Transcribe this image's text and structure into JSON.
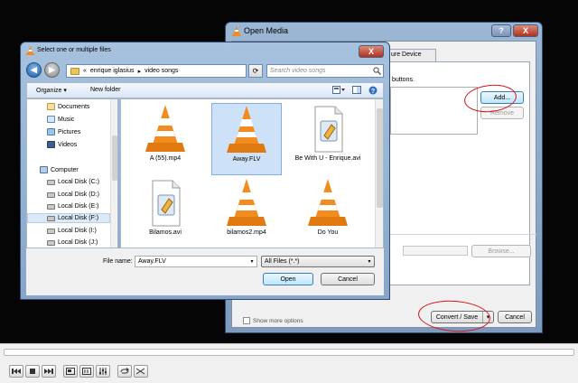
{
  "open_media": {
    "title": "Open Media",
    "help_label": "?",
    "close_label": "X",
    "tabs": [
      "",
      "ure Device"
    ],
    "hint_text": "buttons.",
    "add_label": "Add...",
    "remove_label": "Remove",
    "browse_label": "Browse...",
    "show_more_label": "Show more options",
    "convert_label": "Convert / Save",
    "cancel_label": "Cancel"
  },
  "file_dialog": {
    "title": "Select one or multiple files",
    "close_label": "X",
    "breadcrumb": [
      "«",
      "enrique iglasius",
      "▸",
      "video songs"
    ],
    "search_placeholder": "Search video songs",
    "toolbar": {
      "organize": "Organize ▾",
      "new_folder": "New folder"
    },
    "nav_items": [
      {
        "label": "Documents",
        "icon": "documents-icon"
      },
      {
        "label": "Music",
        "icon": "music-icon"
      },
      {
        "label": "Pictures",
        "icon": "pictures-icon"
      },
      {
        "label": "Videos",
        "icon": "videos-icon"
      },
      {
        "label": "Computer",
        "icon": "computer-icon"
      },
      {
        "label": "Local Disk (C:)",
        "icon": "disk-icon"
      },
      {
        "label": "Local Disk (D:)",
        "icon": "disk-icon"
      },
      {
        "label": "Local Disk (E:)",
        "icon": "disk-icon"
      },
      {
        "label": "Local Disk (F:)",
        "icon": "disk-icon"
      },
      {
        "label": "Local Disk (I:)",
        "icon": "disk-icon"
      },
      {
        "label": "Local Disk (J:)",
        "icon": "disk-icon"
      }
    ],
    "files": [
      {
        "label": "A (55).mp4",
        "type": "vlc-cone-icon"
      },
      {
        "label": "Away.FLV",
        "type": "vlc-cone-icon",
        "selected": true
      },
      {
        "label": "Be With U - Enrique.avi",
        "type": "media-file-icon"
      },
      {
        "label": "Bilamos.avi",
        "type": "media-file-icon"
      },
      {
        "label": "bilamos2.mp4",
        "type": "vlc-cone-icon"
      },
      {
        "label": "Do You",
        "type": "vlc-cone-icon"
      }
    ],
    "file_name_label": "File name:",
    "file_name_value": "Away.FLV",
    "file_type_value": "All Files (*.*)",
    "open_label": "Open",
    "cancel_label": "Cancel"
  },
  "colors": {
    "annotation_red": "#d4141a",
    "vlc_orange": "#f28c1e",
    "aero_blue": "#87a5c8"
  }
}
